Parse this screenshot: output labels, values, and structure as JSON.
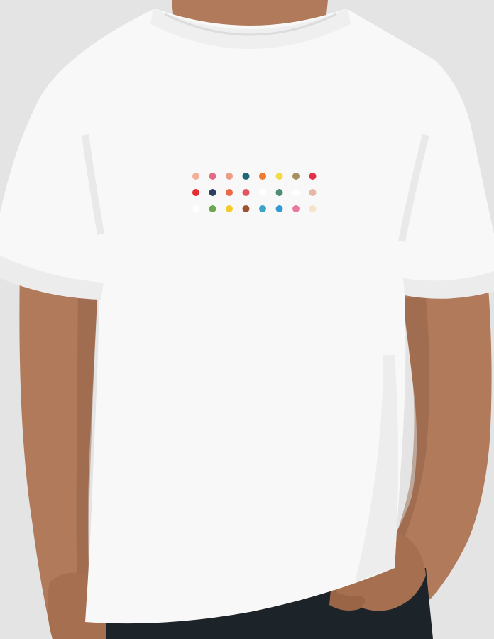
{
  "scene": {
    "subject": "person-wearing-tshirt",
    "background_color": "#e4e4e4",
    "skin_color": "#b07a5b",
    "skin_shadow_color": "#8e5d43",
    "shirt_color": "#f8f8f8",
    "shirt_shadow_color": "#e2e2e2",
    "pants_color": "#1c2329"
  },
  "print": {
    "rows": [
      [
        "#f3b098",
        "#e16b86",
        "#ec9d86",
        "#1f6775",
        "#ea7c33",
        "#f3db43",
        "#a8915e",
        "#e33047"
      ],
      [
        "#e52d34",
        "#2a3f61",
        "#e96a47",
        "#e4535f",
        "#ffffff",
        "#4f8c72",
        "#ffffff",
        "#e6b8a5"
      ],
      [
        "#ffffff",
        "#6aa84f",
        "#f3cc2a",
        "#9b5331",
        "#3fa3c3",
        "#2f9ad4",
        "#e7799a",
        "#f6e3c8"
      ]
    ]
  }
}
